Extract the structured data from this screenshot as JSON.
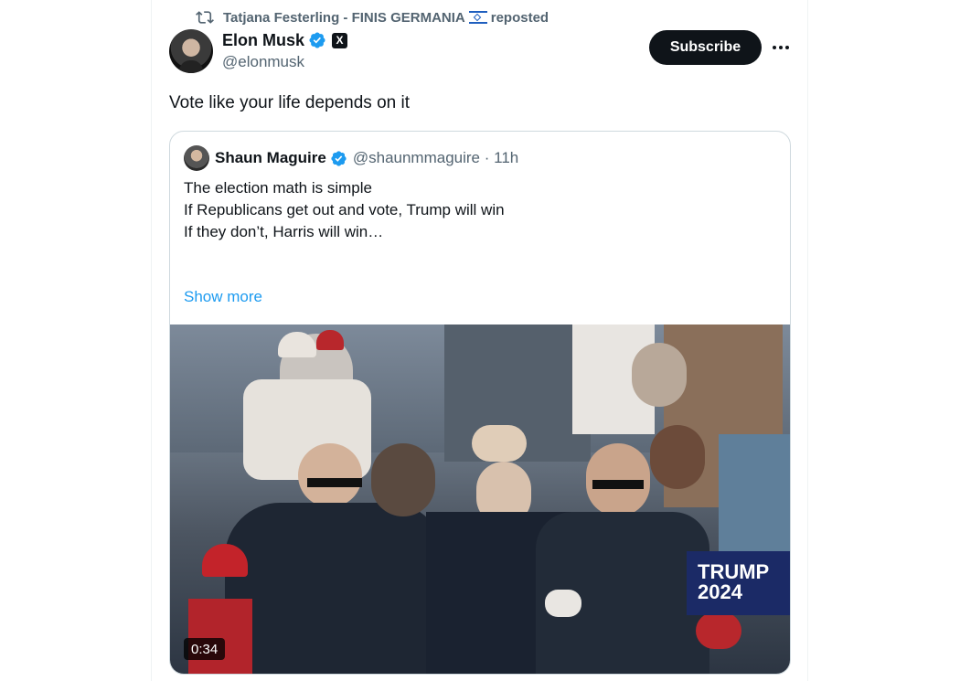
{
  "repost": {
    "text_prefix": "Tatjana Festerling - FINIS GERMANIA",
    "text_suffix": "reposted",
    "icon": "repost-icon"
  },
  "author": {
    "name": "Elon Musk",
    "handle": "@elonmusk",
    "badge": "verified-icon",
    "affiliate_badge": "X"
  },
  "actions": {
    "subscribe_label": "Subscribe",
    "more_icon": "more-icon"
  },
  "tweet": {
    "text": "Vote like your life depends on it"
  },
  "quote": {
    "name": "Shaun Maguire",
    "handle_time": "@shaunmmaguire · 11h",
    "lines": [
      "The election math is simple",
      "",
      "If Republicans get out and vote, Trump will win",
      "",
      "If they don’t, Harris will win…"
    ],
    "show_more": "Show more"
  },
  "media": {
    "duration": "0:34",
    "sign_text": "TRUMP 2024"
  },
  "colors": {
    "text": "#0f1419",
    "secondary": "#536471",
    "link": "#1d9bf0",
    "verified": "#1d9bf0"
  }
}
